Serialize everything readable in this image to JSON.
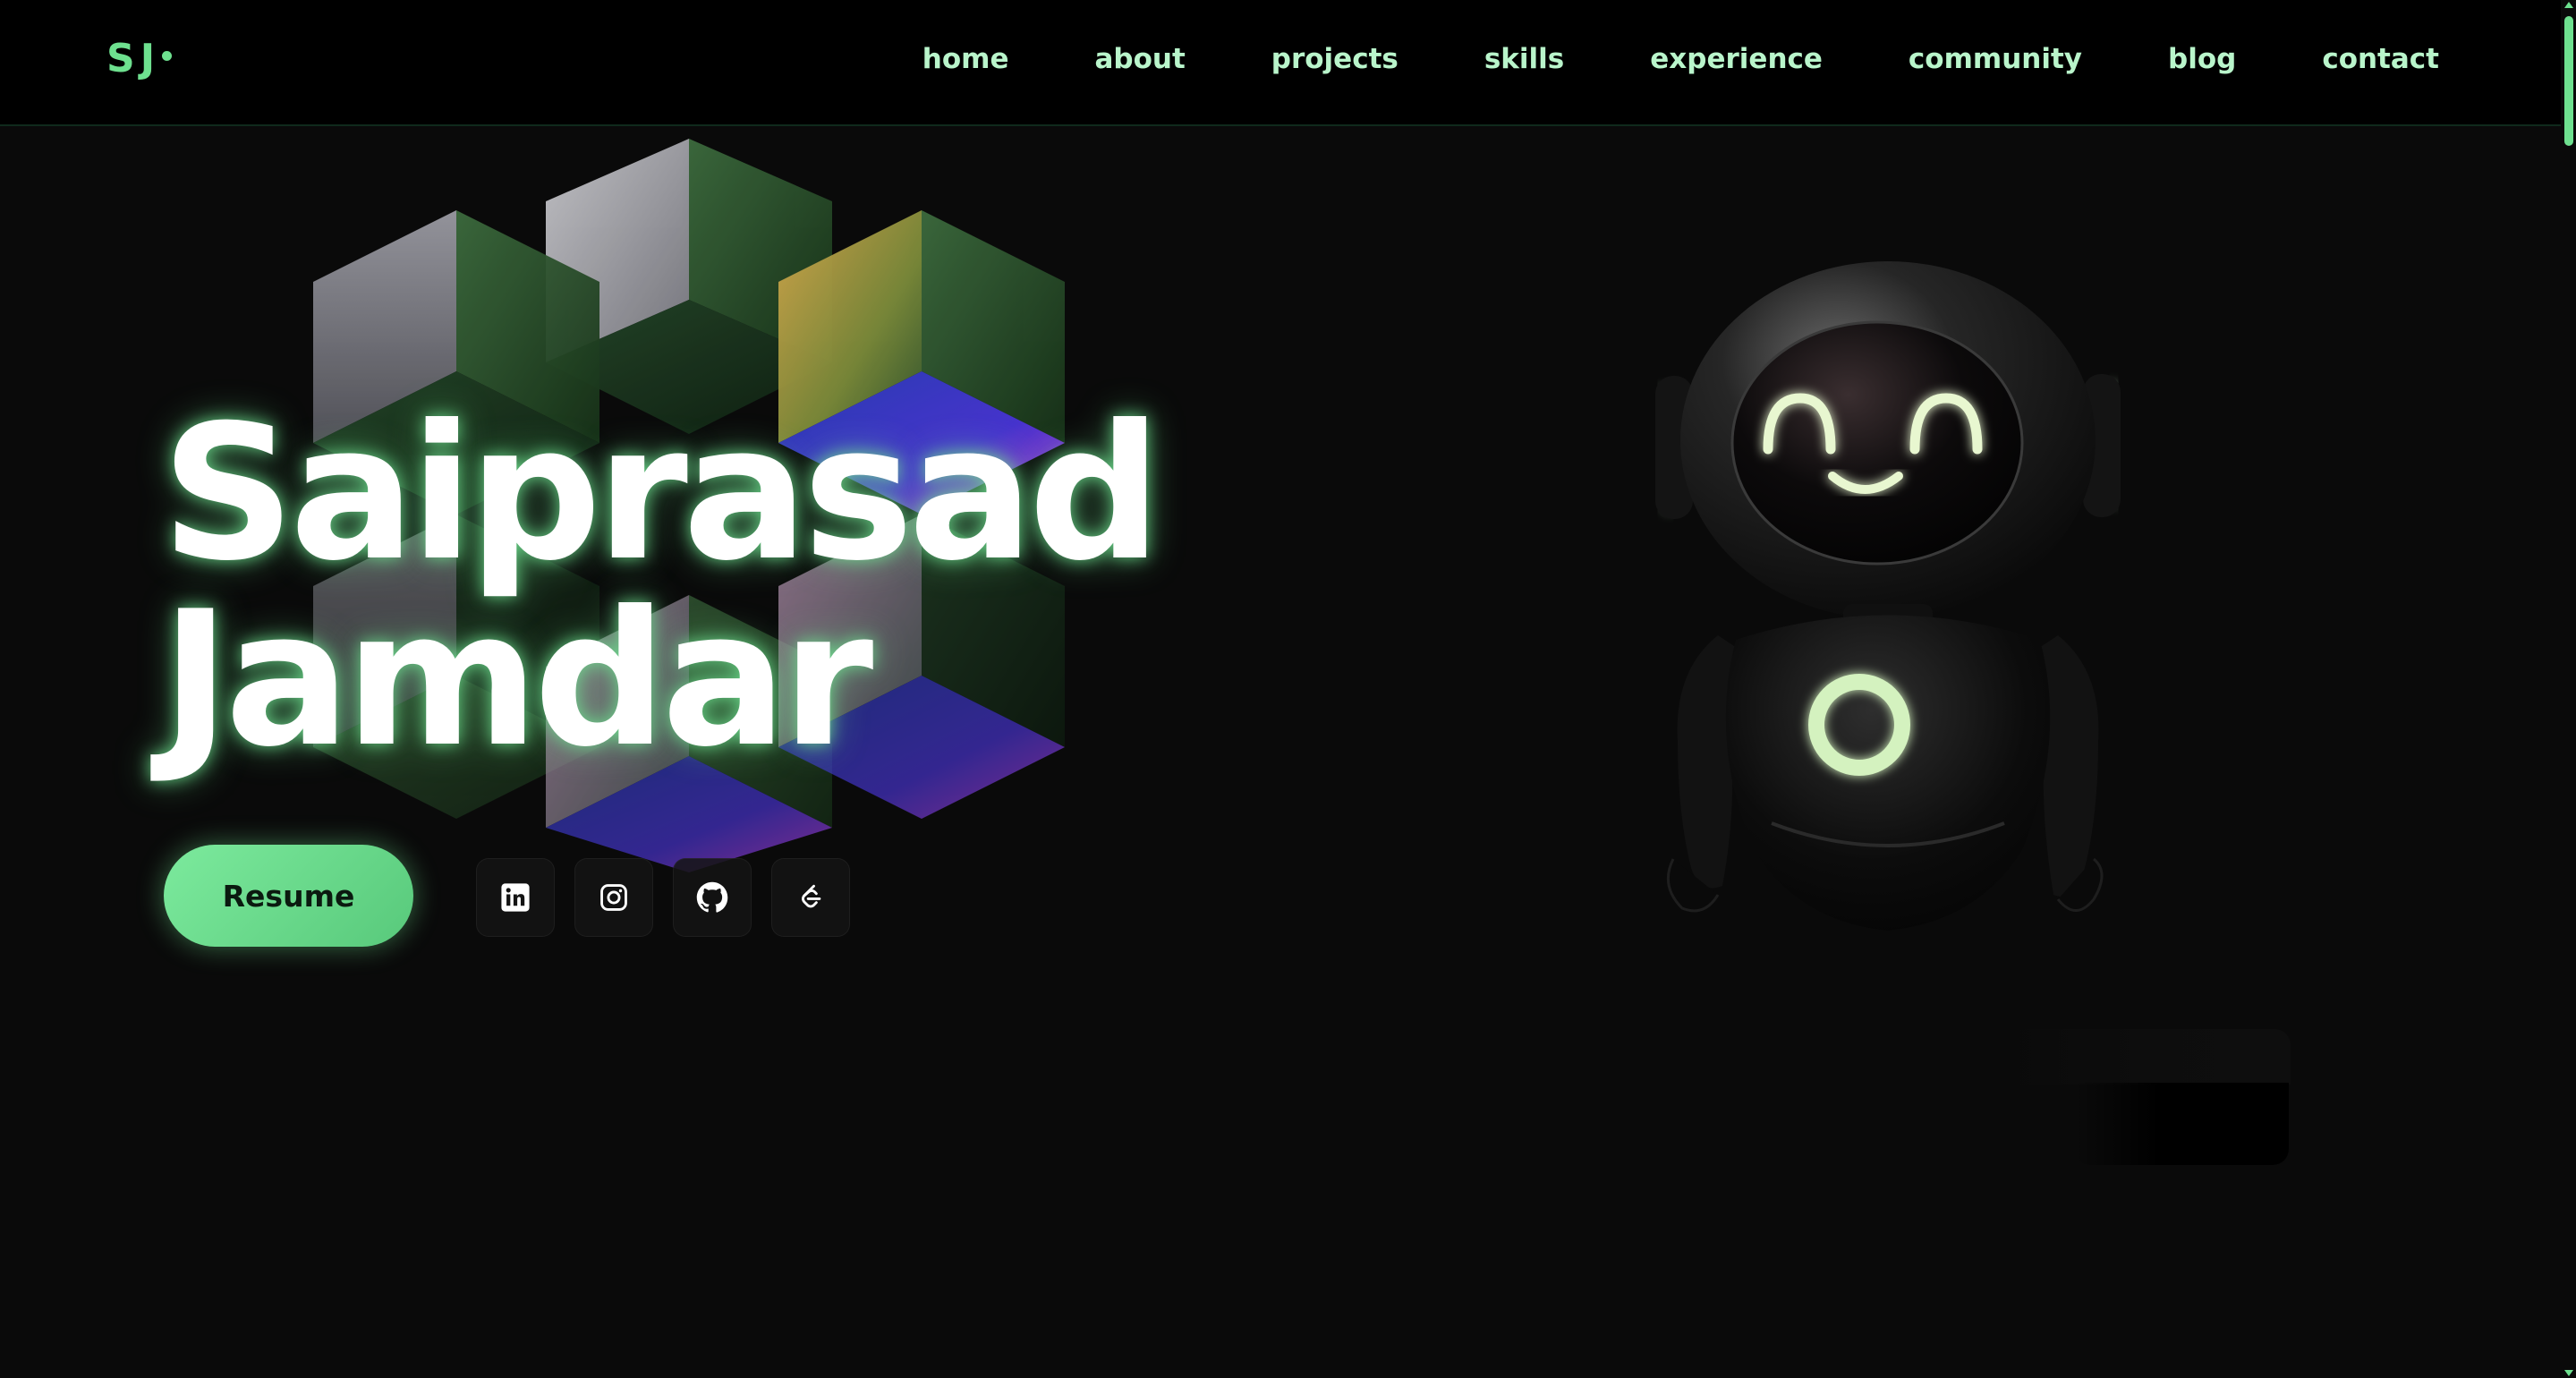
{
  "brand": {
    "logo_text": "SJ"
  },
  "nav": {
    "items": [
      {
        "label": "home"
      },
      {
        "label": "about"
      },
      {
        "label": "projects"
      },
      {
        "label": "skills"
      },
      {
        "label": "experience"
      },
      {
        "label": "community"
      },
      {
        "label": "blog"
      },
      {
        "label": "contact"
      }
    ]
  },
  "hero": {
    "first_name": "Saiprasad",
    "last_name": "Jamdar",
    "resume_label": "Resume",
    "social_icons": [
      "linkedin-icon",
      "instagram-icon",
      "github-icon",
      "leetcode-icon"
    ]
  },
  "colors": {
    "accent": "#6ee08f",
    "nav_text": "#b9f5cb",
    "background": "#0a0a0a",
    "header_bg": "#000000"
  }
}
